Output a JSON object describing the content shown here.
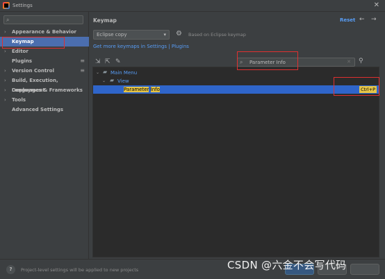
{
  "window": {
    "title": "Settings"
  },
  "sidebar": {
    "search_placeholder": "",
    "items": [
      {
        "label": "Appearance & Behavior",
        "chevron": "›",
        "icon": ""
      },
      {
        "label": "Keymap",
        "chevron": "",
        "icon": ""
      },
      {
        "label": "Editor",
        "chevron": "›",
        "icon": ""
      },
      {
        "label": "Plugins",
        "chevron": "",
        "icon": "≡"
      },
      {
        "label": "Version Control",
        "chevron": "›",
        "icon": "≡"
      },
      {
        "label": "Build, Execution, Deployment",
        "chevron": "›",
        "icon": ""
      },
      {
        "label": "Languages & Frameworks",
        "chevron": "›",
        "icon": ""
      },
      {
        "label": "Tools",
        "chevron": "›",
        "icon": ""
      },
      {
        "label": "Advanced Settings",
        "chevron": "",
        "icon": ""
      }
    ],
    "selected_item": "Keymap"
  },
  "main": {
    "title": "Keymap",
    "reset_label": "Reset",
    "keymap_dropdown": {
      "selected": "Eclipse copy"
    },
    "based_on": "Based on Eclipse keymap",
    "more_keymaps_link": "Get more keymaps in Settings | Plugins",
    "filter": {
      "value": "Parameter Info"
    },
    "tree": {
      "main_menu": "Main Menu",
      "view": "View",
      "action_word1": "Parameter",
      "action_word2": "Info",
      "action_shortcut": "Ctrl+P"
    }
  },
  "footer": {
    "help": "?",
    "note": "Project-level settings will be applied to new projects"
  },
  "watermark": "CSDN @六金不会写代码",
  "colors": {
    "background": "#3c3f41",
    "tree_background": "#2b2b2b",
    "selection": "#4b6eaf",
    "tree_selection": "#2f65ca",
    "link": "#589df6",
    "highlight": "#e6c547",
    "annotation_red": "#e03030"
  },
  "icons": {
    "app": "intellij-logo-icon",
    "close": "✕",
    "search": "⌕",
    "gear": "⚙",
    "back": "←",
    "forward": "→",
    "expand_all": "⇲",
    "collapse_all": "⇱",
    "edit": "✎",
    "find_shortcut": "⚲",
    "clear": "✕",
    "folder": "▰",
    "expand": "⌄",
    "caret": "▾"
  }
}
